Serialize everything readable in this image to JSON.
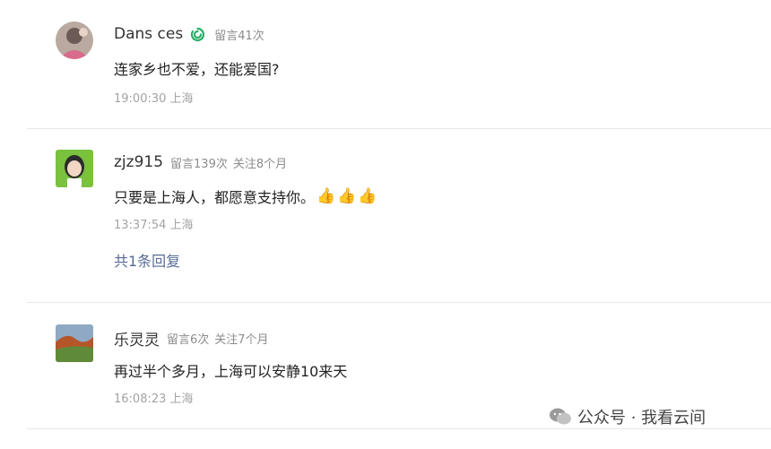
{
  "comments": [
    {
      "username": "Dans ces",
      "badge": "verified-badge",
      "stats": [
        "留言41次"
      ],
      "content": "连家乡也不爱，还能爱国?",
      "time": "19:00:30 上海"
    },
    {
      "username": "zjz915",
      "stats": [
        "留言139次",
        "关注8个月"
      ],
      "content": "只要是上海人，都愿意支持你。",
      "emojis": [
        "👍",
        "👍",
        "👍"
      ],
      "time": "13:37:54 上海",
      "replies": "共1条回复"
    },
    {
      "username": "乐灵灵",
      "stats": [
        "留言6次",
        "关注7个月"
      ],
      "content": "再过半个多月，上海可以安静10来天",
      "time": "16:08:23 上海"
    }
  ],
  "watermark": {
    "text": "公众号 · 我看云间",
    "icon": "wechat-icon"
  },
  "colors": {
    "link": "#576b95",
    "badge": "#2aae67",
    "meta": "#8c8c8c"
  }
}
